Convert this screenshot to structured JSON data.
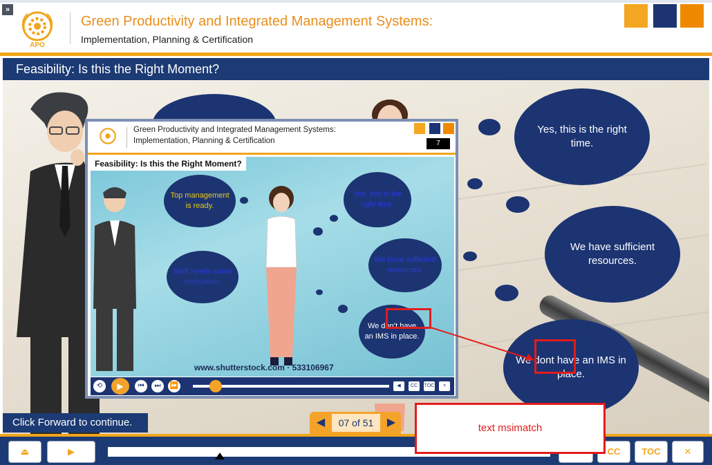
{
  "header": {
    "collapse_label": "»",
    "logo_text": "APO",
    "title": "Green Productivity and Integrated Management Systems:",
    "subtitle": "Implementation, Planning & Certification",
    "squares": [
      "#f5a623",
      "#1c3472",
      "#ef8a00"
    ]
  },
  "slide": {
    "title": "Feasibility: Is this the Right Moment?",
    "clouds": [
      {
        "text": "Yes, this is the right time."
      },
      {
        "text": "We have sufficient resources."
      },
      {
        "text": "We dont have an IMS in place."
      }
    ]
  },
  "inner_window": {
    "title": "Green Productivity and Integrated Management Systems:",
    "subtitle": "Implementation, Planning & Certification",
    "slide_number": "7",
    "slide_title": "Feasibility: Is this the Right Moment?",
    "clouds": [
      {
        "text": "Top management is ready.",
        "color": "#e9c81c"
      },
      {
        "text": "Yes, this is the right time.",
        "color": "#2a39d9"
      },
      {
        "text": "We have sufficient resources.",
        "color": "#2a39d9"
      },
      {
        "text": "Staff needs some motivation.",
        "color": "#2a39d9"
      },
      {
        "text": "We don’t have an IMS in place.",
        "color": "#ffffff"
      }
    ],
    "watermark": "www.shutterstock.com · 533106967",
    "controls": {
      "cc": "CC",
      "toc": "TOC",
      "close": "×"
    }
  },
  "footer": {
    "click_forward": "Click Forward to continue.",
    "slide_counter": "07 of 51",
    "buttons": {
      "exit": "⏏",
      "play": "▶",
      "cc": "CC",
      "toc": "TOC",
      "close": "✕"
    }
  },
  "annotation": {
    "label": "text msimatch",
    "color": "#e21c1c"
  }
}
